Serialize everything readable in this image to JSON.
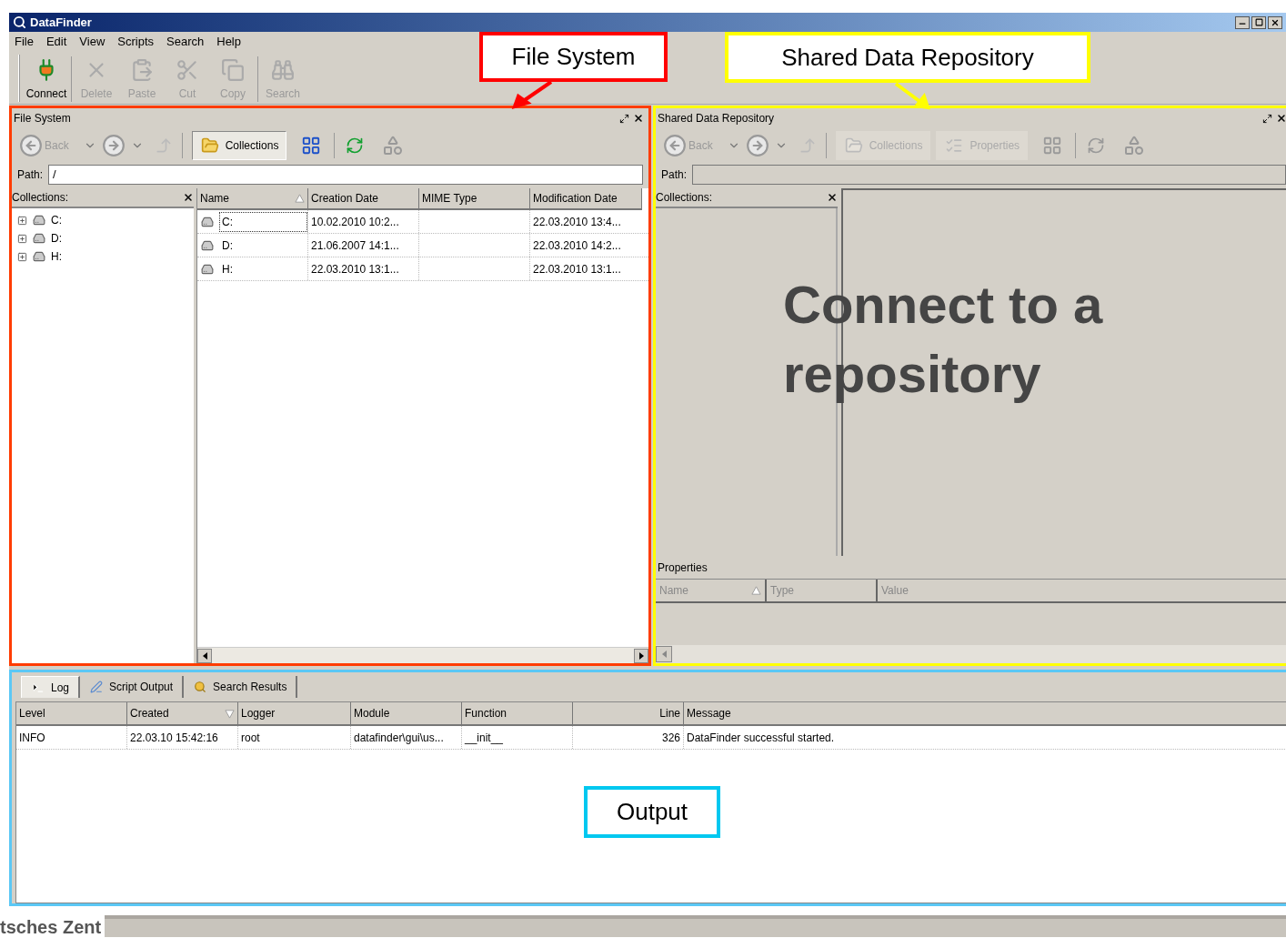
{
  "window": {
    "title": "DataFinder"
  },
  "menu": [
    {
      "label": "File"
    },
    {
      "label": "Edit"
    },
    {
      "label": "View"
    },
    {
      "label": "Scripts"
    },
    {
      "label": "Search"
    },
    {
      "label": "Help"
    }
  ],
  "toolbar": [
    {
      "label": "Connect",
      "kind": "connect",
      "disabled": false
    },
    {
      "label": "Delete",
      "kind": "delete",
      "disabled": true
    },
    {
      "label": "Paste",
      "kind": "paste",
      "disabled": true
    },
    {
      "label": "Cut",
      "kind": "cut",
      "disabled": true
    },
    {
      "label": "Copy",
      "kind": "copy",
      "disabled": true
    },
    {
      "label": "Search",
      "kind": "search",
      "disabled": true
    }
  ],
  "annotations": [
    {
      "label": "File System",
      "color": "#ff0000"
    },
    {
      "label": "Shared Data Repository",
      "color": "#ffff00"
    },
    {
      "label": "Output",
      "color": "#00c8f0"
    }
  ],
  "file_system": {
    "title": "File System",
    "back": "Back",
    "views": [
      {
        "label": "Collections",
        "kind": "collections",
        "selected": true
      }
    ],
    "path_label": "Path:",
    "path": "/",
    "collections_title": "Collections:",
    "tree": [
      {
        "label": "C:"
      },
      {
        "label": "D:"
      },
      {
        "label": "H:"
      }
    ],
    "columns": [
      {
        "label": "Name",
        "sorted": true,
        "descending": false
      },
      {
        "label": "Creation Date",
        "sorted": false
      },
      {
        "label": "MIME Type",
        "sorted": false
      },
      {
        "label": "Modification Date",
        "sorted": false
      }
    ],
    "rows": [
      {
        "name": "C:",
        "creation_date": "10.02.2010 10:2...",
        "modification_date": "22.03.2010 13:4...",
        "focused": true
      },
      {
        "name": "D:",
        "creation_date": "21.06.2007 14:1...",
        "modification_date": "22.03.2010 14:2...",
        "focused": false
      },
      {
        "name": "H:",
        "creation_date": "22.03.2010 13:1...",
        "modification_date": "22.03.2010 13:1...",
        "focused": false
      }
    ]
  },
  "repository": {
    "title": "Shared Data Repository",
    "connected": false,
    "back": "Back",
    "views": [
      {
        "label": "Collections",
        "kind": "collections",
        "selected": false
      },
      {
        "label": "Properties",
        "kind": "properties",
        "selected": false
      }
    ],
    "path_label": "Path:",
    "collections_title": "Collections:",
    "message": "Connect to a repository",
    "properties_title": "Properties",
    "property_columns": [
      {
        "label": "Name",
        "sorted": true,
        "descending": false
      },
      {
        "label": "Type",
        "sorted": false
      },
      {
        "label": "Value",
        "sorted": false
      }
    ]
  },
  "output": {
    "tabs": [
      {
        "label": "Log",
        "kind": "log",
        "selected": true
      },
      {
        "label": "Script Output",
        "kind": "script",
        "selected": false
      },
      {
        "label": "Search Results",
        "kind": "search",
        "selected": false
      }
    ],
    "columns": [
      {
        "label": "Level",
        "sorted": false,
        "kind": "text"
      },
      {
        "label": "Created",
        "sorted": true,
        "descending": true,
        "kind": "text"
      },
      {
        "label": "Logger",
        "sorted": false,
        "kind": "text"
      },
      {
        "label": "Module",
        "sorted": false,
        "kind": "text"
      },
      {
        "label": "Function",
        "sorted": false,
        "kind": "text"
      },
      {
        "label": "Line",
        "sorted": false,
        "kind": "number"
      },
      {
        "label": "Message",
        "sorted": false,
        "kind": "text"
      }
    ],
    "rows": [
      {
        "cells": [
          "INFO",
          "22.03.10 15:42:16",
          "root",
          "datafinder\\gui\\us...",
          "__init__",
          "326",
          "DataFinder successful started."
        ]
      }
    ]
  },
  "footer_fragment": "tsches Zent"
}
